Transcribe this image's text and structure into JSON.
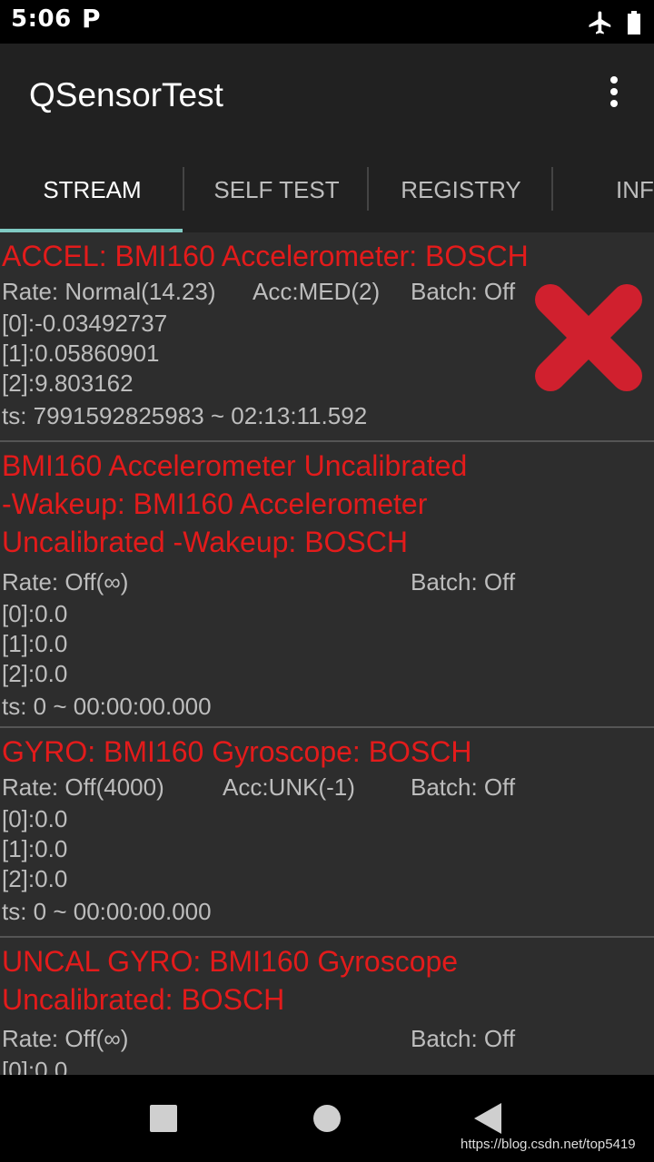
{
  "status_bar": {
    "time": "5:06",
    "notification_icon": "P",
    "icons": [
      "airplane-mode-icon",
      "battery-icon"
    ]
  },
  "app_bar": {
    "title": "QSensorTest",
    "menu_icon": "overflow-menu-icon"
  },
  "tabs": [
    {
      "label": "STREAM",
      "active": true
    },
    {
      "label": "SELF TEST",
      "active": false
    },
    {
      "label": "REGISTRY",
      "active": false
    },
    {
      "label": "INF",
      "active": false
    }
  ],
  "sensors": [
    {
      "name": "ACCEL: BMI160 Accelerometer: BOSCH",
      "rate": "Rate: Normal(14.23)",
      "acc": "Acc:MED(2)",
      "batch": "Batch: Off",
      "values": [
        "[0]:-0.03492737",
        "[1]:0.05860901",
        "[2]:9.803162"
      ],
      "ts": "ts: 7991592825983 ~ 02:13:11.592"
    },
    {
      "name_lines": [
        "BMI160 Accelerometer Uncalibrated",
        "-Wakeup: BMI160 Accelerometer",
        "Uncalibrated -Wakeup: BOSCH"
      ],
      "rate": "Rate: Off(∞)",
      "batch": "Batch: Off",
      "values": [
        "[0]:0.0",
        "[1]:0.0",
        "[2]:0.0"
      ],
      "ts": "ts: 0 ~ 00:00:00.000"
    },
    {
      "name": "GYRO: BMI160 Gyroscope: BOSCH",
      "rate": "Rate: Off(4000)",
      "acc": "Acc:UNK(-1)",
      "batch": "Batch: Off",
      "values": [
        "[0]:0.0",
        "[1]:0.0",
        "[2]:0.0"
      ],
      "ts": "ts: 0 ~ 00:00:00.000"
    },
    {
      "name_lines": [
        "UNCAL GYRO: BMI160 Gyroscope",
        "Uncalibrated: BOSCH"
      ],
      "rate": "Rate: Off(∞)",
      "batch": "Batch: Off",
      "values": [
        "[0]:0.0"
      ]
    }
  ],
  "overlay": {
    "icon": "red-x-icon",
    "color": "#d0202e"
  },
  "nav_bar": {
    "icons": [
      "recents-square-icon",
      "home-circle-icon",
      "back-triangle-icon"
    ]
  },
  "watermark": "https://blog.csdn.net/top5419"
}
